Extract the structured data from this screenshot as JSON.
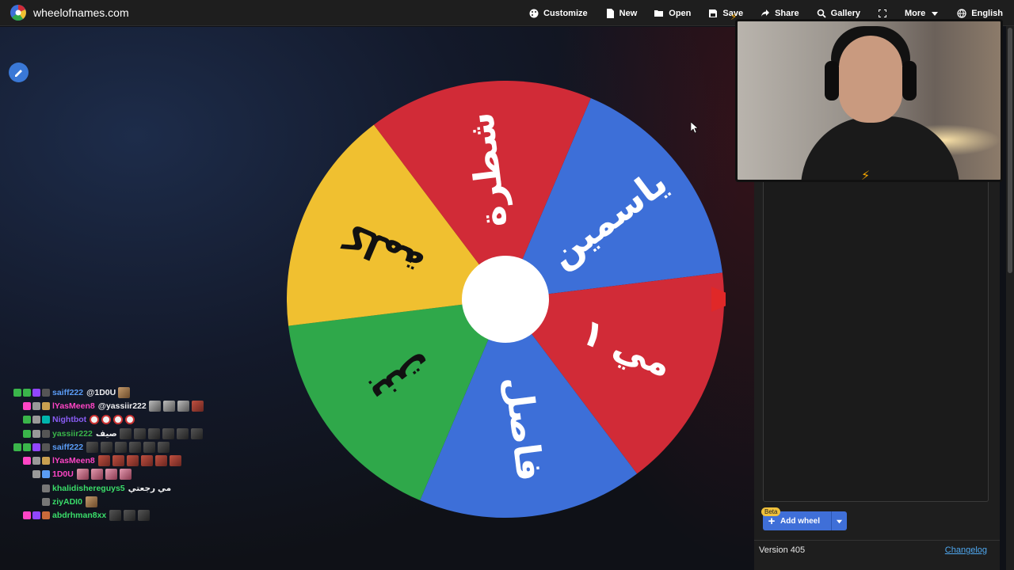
{
  "app": {
    "title": "wheelofnames.com",
    "version": "Version 405",
    "changelog": "Changelog"
  },
  "nav": [
    {
      "label": "Customize",
      "icon": "palette-icon"
    },
    {
      "label": "New",
      "icon": "file-icon"
    },
    {
      "label": "Open",
      "icon": "folder-open-icon"
    },
    {
      "label": "Save",
      "icon": "floppy-icon"
    },
    {
      "label": "Share",
      "icon": "share-icon"
    },
    {
      "label": "Gallery",
      "icon": "search-icon"
    },
    {
      "label": "",
      "icon": "fullscreen-icon"
    },
    {
      "label": "More",
      "icon": "chevron-down-icon"
    },
    {
      "label": "English",
      "icon": "globe-icon"
    }
  ],
  "wheel": {
    "segments": [
      {
        "label": "ياسمين",
        "color": "#3d6fd8"
      },
      {
        "label": "مي ١",
        "color": "#d12b37"
      },
      {
        "label": "فاصل",
        "color": "#3d6fd8"
      },
      {
        "label": "بنت",
        "color": "#2fa84a"
      },
      {
        "label": "كلمة",
        "color": "#f0c030"
      },
      {
        "label": "شطرة",
        "color": "#d12b37"
      }
    ],
    "pointer_color": "#e02828"
  },
  "panel": {
    "beta_label": "Beta",
    "add_wheel_label": "Add wheel"
  },
  "chat": [
    {
      "user": "saiff222",
      "color": "#5a9cf5",
      "msg": "@1D0U",
      "emotes": [
        "tan"
      ],
      "badges": [
        "#3ab54a",
        "#3ab54a",
        "#9146ff",
        "#555"
      ]
    },
    {
      "user": "lYasMeen8",
      "color": "#ff45c5",
      "msg": "@yassiir222",
      "emotes": [
        "gray",
        "gray",
        "gray",
        "red"
      ],
      "badges": [
        "#ff45c5",
        "#999",
        "#c9a050"
      ]
    },
    {
      "user": "Nightbot",
      "color": "#8a5cf5",
      "msg": "",
      "emotes": [
        "face",
        "face",
        "face",
        "face"
      ],
      "badges": [
        "#3ab54a",
        "#999",
        "#00b5ad"
      ]
    },
    {
      "user": "yassiir222",
      "color": "#3ab54a",
      "msg": "صيف",
      "emotes": [
        "dark",
        "dark",
        "dark",
        "dark",
        "dark",
        "dark"
      ],
      "badges": [
        "#3ab54a",
        "#999",
        "#555"
      ]
    },
    {
      "user": "saiff222",
      "color": "#5a9cf5",
      "msg": "",
      "emotes": [
        "dark",
        "dark",
        "dark",
        "dark",
        "dark",
        "dark"
      ],
      "badges": [
        "#3ab54a",
        "#3ab54a",
        "#9146ff",
        "#555"
      ]
    },
    {
      "user": "lYasMeen8",
      "color": "#ff45c5",
      "msg": "",
      "emotes": [
        "red",
        "red",
        "red",
        "red",
        "red",
        "red"
      ],
      "badges": [
        "#ff45c5",
        "#999",
        "#c9a050"
      ]
    },
    {
      "user": "1D0U",
      "color": "#ff45c5",
      "msg": "",
      "emotes": [
        "pink",
        "pink",
        "pink",
        "pink"
      ],
      "badges": [
        "#999",
        "#5a9cf5"
      ]
    },
    {
      "user": "khalidishereguys5",
      "color": "#3ade6a",
      "msg": "مي رجعتي",
      "emotes": [],
      "badges": [
        "#777"
      ]
    },
    {
      "user": "ziyADI0",
      "color": "#3ade6a",
      "msg": "",
      "emotes": [
        "tan"
      ],
      "badges": [
        "#777"
      ]
    },
    {
      "user": "abdrhman8xx",
      "color": "#3ade6a",
      "msg": "",
      "emotes": [
        "dark",
        "dark",
        "dark"
      ],
      "badges": [
        "#ff45c5",
        "#9146ff",
        "#c96a3a"
      ]
    }
  ]
}
